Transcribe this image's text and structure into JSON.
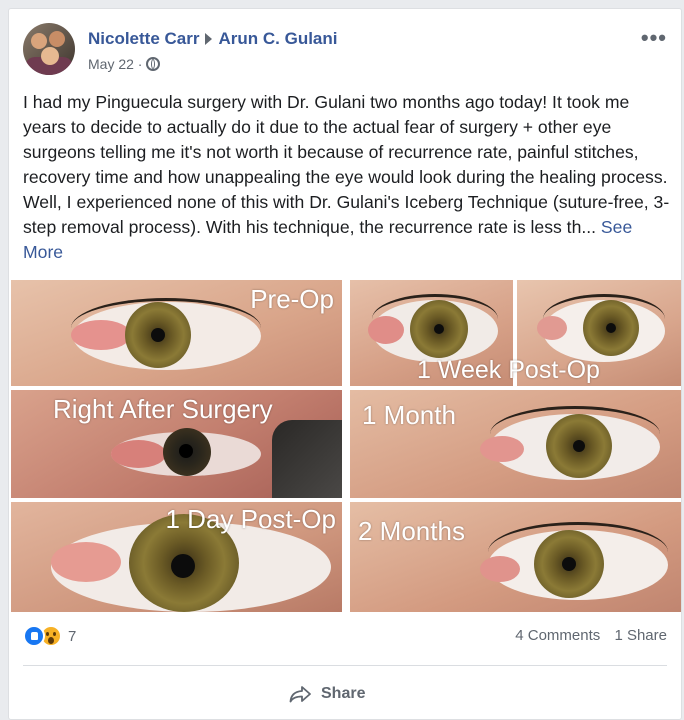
{
  "post": {
    "author": "Nicolette Carr",
    "recipient": "Arun C. Gulani",
    "date": "May 22 ·",
    "more_label": "•••",
    "text": "I had my Pinguecula surgery with Dr. Gulani two months ago today! It took me years to decide to actually do it due to the actual fear of surgery + other eye surgeons telling me it's not worth it because of recurrence rate, painful stitches, recovery time and how unappealing the eye would look during the healing process. Well, I experienced none of this with Dr. Gulani's Iceberg Technique (suture-free, 3-step removal process). With his technique, the recurrence rate is less th...",
    "see_more": " See More"
  },
  "photos": {
    "pre_op": "Pre-Op",
    "right_after": "Right After Surgery",
    "one_day": "1 Day Post-Op",
    "one_week": "1 Week Post-Op",
    "one_month": "1 Month",
    "two_months": "2 Months"
  },
  "stats": {
    "reaction_count": "7",
    "comments": "4 Comments",
    "shares": "1 Share"
  },
  "actions": {
    "share_label": "Share"
  },
  "icons": [
    "avatar",
    "arrow-right-icon",
    "globe-icon",
    "more-icon",
    "like-reaction-icon",
    "wow-reaction-icon",
    "share-icon"
  ]
}
